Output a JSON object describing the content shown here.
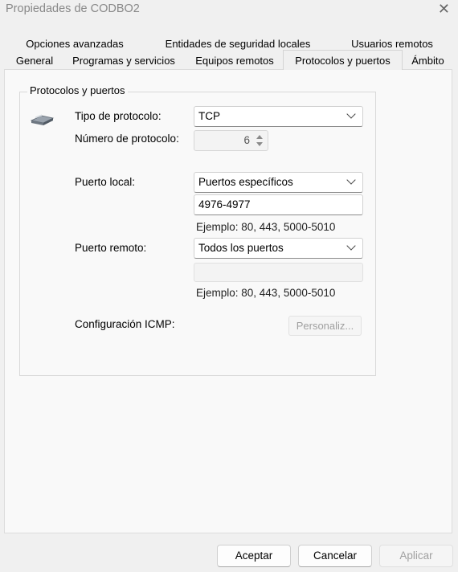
{
  "window": {
    "title": "Propiedades de CODBO2",
    "close_glyph": "✕"
  },
  "tabs_row1": [
    "Opciones avanzadas",
    "Entidades de seguridad locales",
    "Usuarios remotos"
  ],
  "tabs_row2": [
    "General",
    "Programas y servicios",
    "Equipos remotos",
    "Protocolos y puertos",
    "Ámbito"
  ],
  "active_tab": "Protocolos y puertos",
  "group": {
    "title": "Protocolos y puertos"
  },
  "protocol": {
    "icon": "network-plug-icon",
    "type_label": "Tipo de protocolo:",
    "type_value": "TCP",
    "number_label": "Número de protocolo:",
    "number_value": "6"
  },
  "local_port": {
    "label": "Puerto local:",
    "value": "Puertos específicos",
    "ports": "4976-4977",
    "example": "Ejemplo: 80, 443, 5000-5010"
  },
  "remote_port": {
    "label": "Puerto remoto:",
    "value": "Todos los puertos",
    "ports": "",
    "example": "Ejemplo: 80, 443, 5000-5010"
  },
  "icmp": {
    "label": "Configuración ICMP:",
    "button": "Personaliz..."
  },
  "footer": {
    "accept": "Aceptar",
    "cancel": "Cancelar",
    "apply": "Aplicar"
  }
}
